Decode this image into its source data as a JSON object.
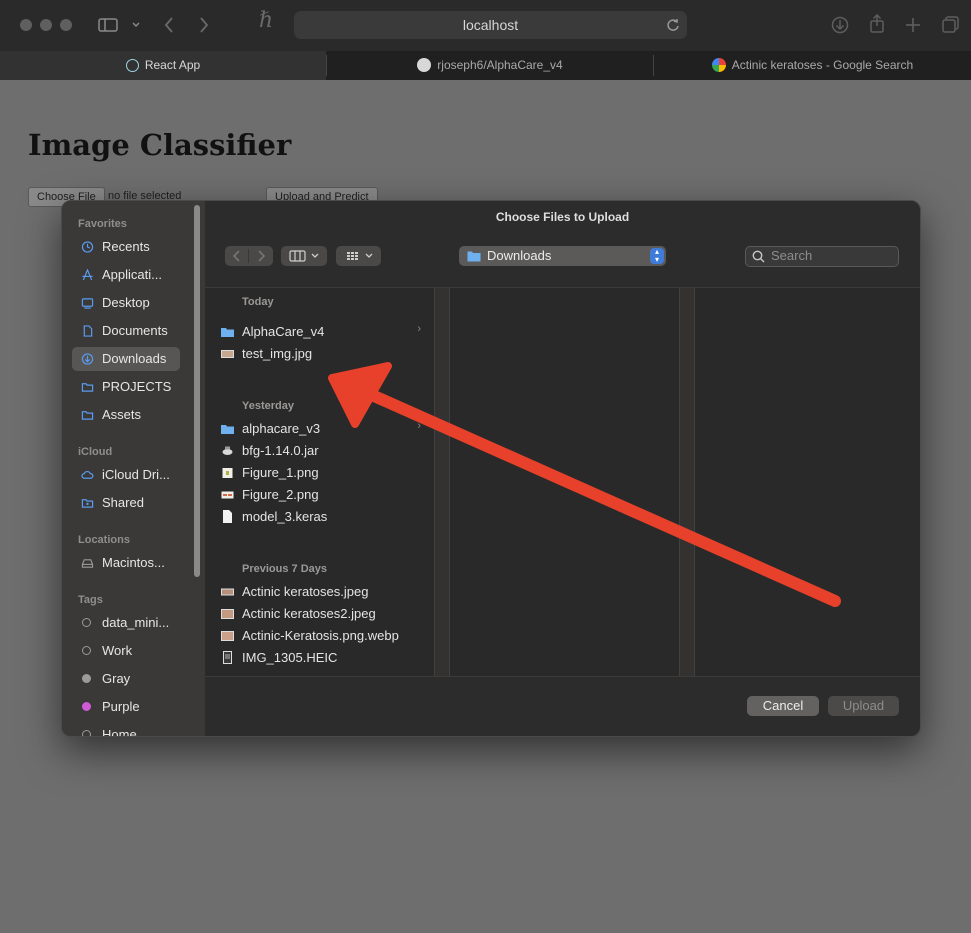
{
  "browser": {
    "address": "localhost",
    "tabs": [
      {
        "label": "React App",
        "active": true
      },
      {
        "label": "rjoseph6/AlphaCare_v4",
        "active": false
      },
      {
        "label": "Actinic keratoses - Google Search",
        "active": false
      }
    ]
  },
  "page": {
    "title": "Image Classifier",
    "choose_file_label": "Choose File",
    "file_status": "no file selected",
    "upload_predict_label": "Upload and Predict"
  },
  "dialog": {
    "title": "Choose Files to Upload",
    "location": "Downloads",
    "search_placeholder": "Search",
    "sidebar": {
      "favorites_header": "Favorites",
      "favorites": [
        "Recents",
        "Applicati...",
        "Desktop",
        "Documents",
        "Downloads",
        "PROJECTS",
        "Assets"
      ],
      "selected": "Downloads",
      "icloud_header": "iCloud",
      "icloud": [
        "iCloud Dri...",
        "Shared"
      ],
      "locations_header": "Locations",
      "locations": [
        "Macintos..."
      ],
      "tags_header": "Tags",
      "tags": [
        {
          "label": "data_mini...",
          "color": ""
        },
        {
          "label": "Work",
          "color": ""
        },
        {
          "label": "Gray",
          "color": "#9b9b9b"
        },
        {
          "label": "Purple",
          "color": "#d15ad6"
        },
        {
          "label": "Home",
          "color": ""
        }
      ]
    },
    "groups": [
      {
        "label": "Today",
        "files": [
          {
            "name": "AlphaCare_v4",
            "kind": "folder"
          },
          {
            "name": "test_img.jpg",
            "kind": "image"
          }
        ]
      },
      {
        "label": "Yesterday",
        "files": [
          {
            "name": "alphacare_v3",
            "kind": "folder"
          },
          {
            "name": "bfg-1.14.0.jar",
            "kind": "jar"
          },
          {
            "name": "Figure_1.png",
            "kind": "image"
          },
          {
            "name": "Figure_2.png",
            "kind": "image"
          },
          {
            "name": "model_3.keras",
            "kind": "document"
          }
        ]
      },
      {
        "label": "Previous 7 Days",
        "files": [
          {
            "name": "Actinic keratoses.jpeg",
            "kind": "image"
          },
          {
            "name": "Actinic keratoses2.jpeg",
            "kind": "image"
          },
          {
            "name": "Actinic-Keratosis.png.webp",
            "kind": "image"
          },
          {
            "name": "IMG_1305.HEIC",
            "kind": "image"
          }
        ]
      }
    ],
    "cancel_label": "Cancel",
    "upload_label": "Upload"
  },
  "annotation": {
    "color": "#e8412b"
  }
}
